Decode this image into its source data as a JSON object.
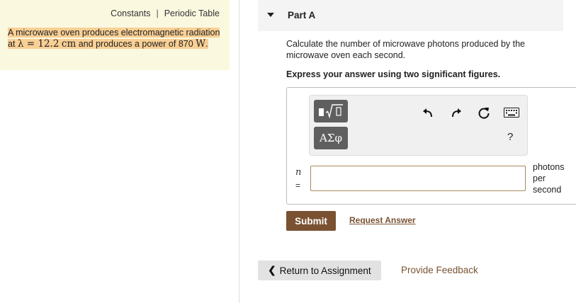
{
  "header_links": {
    "constants": "Constants",
    "separator": "|",
    "periodic_table": "Periodic Table"
  },
  "problem": {
    "text1": "A microwave oven produces electromagnetic radiation at ",
    "lambda_symbol": "λ",
    "equals": " = ",
    "wavelength_value": "12.2",
    "wavelength_unit": "cm",
    "text2": " and produces a power of ",
    "power_value": "870",
    "power_unit": "W",
    "period": "."
  },
  "part": {
    "title": "Part A"
  },
  "question": "Calculate the number of microwave photons produced by the microwave oven each second.",
  "instruction": "Express your answer using two significant figures.",
  "toolbar": {
    "templates_icon": "square-radical-icon",
    "symbols_label": "ΑΣφ",
    "undo_icon": "undo-icon",
    "redo_icon": "redo-icon",
    "reset_icon": "reset-icon",
    "keyboard_icon": "keyboard-icon",
    "help_label": "?"
  },
  "answer": {
    "variable": "n",
    "equals": "=",
    "value": "",
    "units": [
      "photons",
      "per",
      "second"
    ]
  },
  "buttons": {
    "submit": "Submit",
    "request_answer": "Request Answer",
    "return_chevron": "❮",
    "return": "Return to Assignment",
    "feedback": "Provide Feedback"
  },
  "colors": {
    "accent_brown": "#7a5232",
    "highlight": "#f8cf94",
    "panel_bg": "#fbf8e0"
  }
}
